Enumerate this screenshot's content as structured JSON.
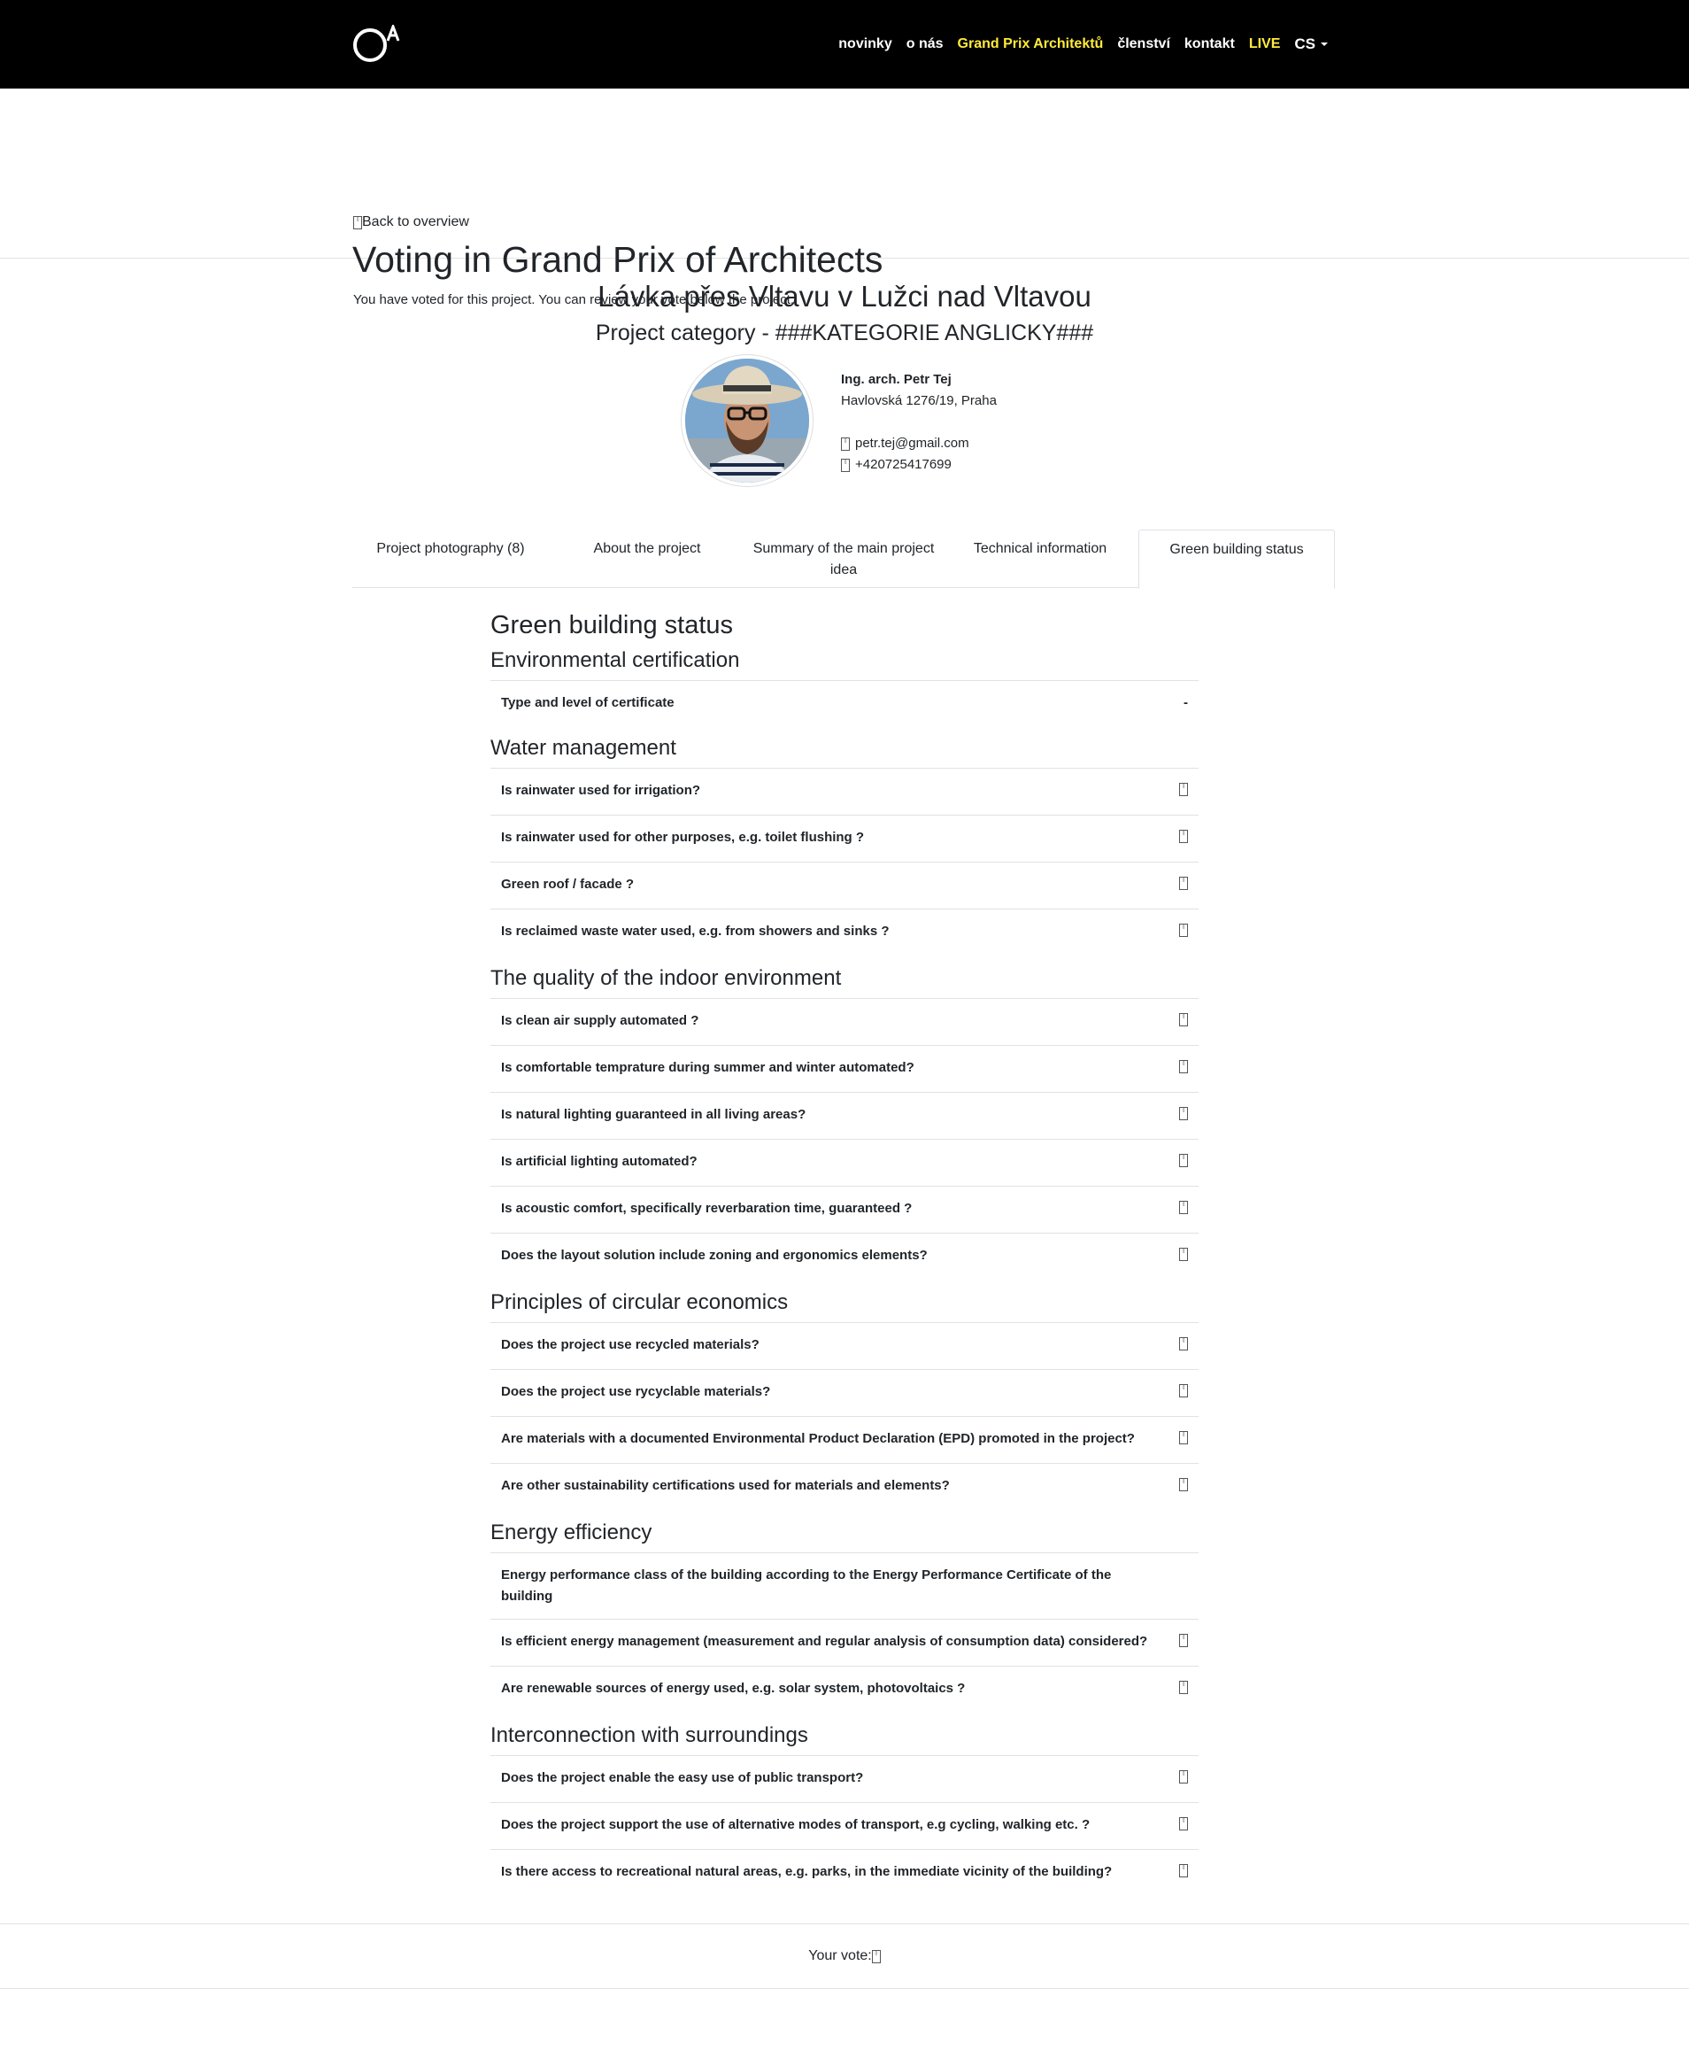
{
  "nav": {
    "items": [
      {
        "label": "novinky",
        "highlight": false
      },
      {
        "label": "o nás",
        "highlight": false
      },
      {
        "label": "Grand Prix Architektů",
        "highlight": true
      },
      {
        "label": "členství",
        "highlight": false
      },
      {
        "label": "kontakt",
        "highlight": false
      },
      {
        "label": "LIVE",
        "highlight": true
      }
    ],
    "language": "CS",
    "highlight_color": "#ffeb3b"
  },
  "header": {
    "back_label": "Back to overview",
    "title": "Voting in Grand Prix of Architects",
    "notice": "You have voted for this project. You can review your vote below the project."
  },
  "project": {
    "title": "Lávka přes Vltavu v Lužci nad Vltavou",
    "category": "Project category - ###KATEGORIE ANGLICKY###",
    "author": {
      "name": "Ing. arch. Petr Tej",
      "address": "Havlovská 1276/19, Praha",
      "email": "petr.tej@gmail.com",
      "phone": "+420725417699"
    }
  },
  "tabs": [
    {
      "label": "Project photography (8)",
      "active": false
    },
    {
      "label": "About the project",
      "active": false
    },
    {
      "label": "Summary of the main project idea",
      "active": false
    },
    {
      "label": "Technical information",
      "active": false
    },
    {
      "label": "Green building status",
      "active": true
    }
  ],
  "green": {
    "heading": "Green building status",
    "sections": [
      {
        "title": "Environmental certification",
        "rows": [
          {
            "q": "Type and level of certificate",
            "a": "-"
          }
        ]
      },
      {
        "title": "Water management",
        "rows": [
          {
            "q": "Is rainwater used for irrigation?",
            "a": "glyph"
          },
          {
            "q": "Is rainwater used for other purposes, e.g. toilet flushing ?",
            "a": "glyph"
          },
          {
            "q": "Green roof / facade ?",
            "a": "glyph"
          },
          {
            "q": "Is reclaimed waste water used, e.g. from showers and sinks ?",
            "a": "glyph"
          }
        ]
      },
      {
        "title": "The quality of the indoor environment",
        "rows": [
          {
            "q": "Is clean air supply automated ?",
            "a": "glyph"
          },
          {
            "q": "Is comfortable temprature during summer and winter automated?",
            "a": "glyph"
          },
          {
            "q": "Is natural lighting guaranteed in all living areas?",
            "a": "glyph"
          },
          {
            "q": "Is artificial lighting automated?",
            "a": "glyph"
          },
          {
            "q": "Is acoustic comfort, specifically reverbaration time, guaranteed ?",
            "a": "glyph"
          },
          {
            "q": "Does the layout solution include zoning and ergonomics elements?",
            "a": "glyph"
          }
        ]
      },
      {
        "title": "Principles of circular economics",
        "rows": [
          {
            "q": "Does the project use recycled materials?",
            "a": "glyph"
          },
          {
            "q": "Does the project use rycyclable materials?",
            "a": "glyph"
          },
          {
            "q": "Are materials with a documented Environmental Product Declaration (EPD) promoted in the project?",
            "a": "glyph"
          },
          {
            "q": "Are other sustainability certifications used for materials and elements?",
            "a": "glyph"
          }
        ]
      },
      {
        "title": "Energy efficiency",
        "rows": [
          {
            "q": "Energy performance class of the building according to the Energy Performance Certificate of the building",
            "a": ""
          },
          {
            "q": "Is efficient energy management (measurement and regular analysis of consumption data) considered?",
            "a": "glyph"
          },
          {
            "q": "Are renewable sources of energy used, e.g. solar system, photovoltaics ?",
            "a": "glyph"
          }
        ]
      },
      {
        "title": "Interconnection with surroundings",
        "rows": [
          {
            "q": "Does the project enable the easy use of public transport?",
            "a": "glyph"
          },
          {
            "q": "Does the project support the use of alternative modes of transport, e.g cycling, walking etc. ?",
            "a": "glyph"
          },
          {
            "q": "Is there access to recreational natural areas, e.g. parks, in the immediate vicinity of the building?",
            "a": "glyph"
          }
        ]
      }
    ]
  },
  "vote": {
    "label": "Your vote:"
  }
}
